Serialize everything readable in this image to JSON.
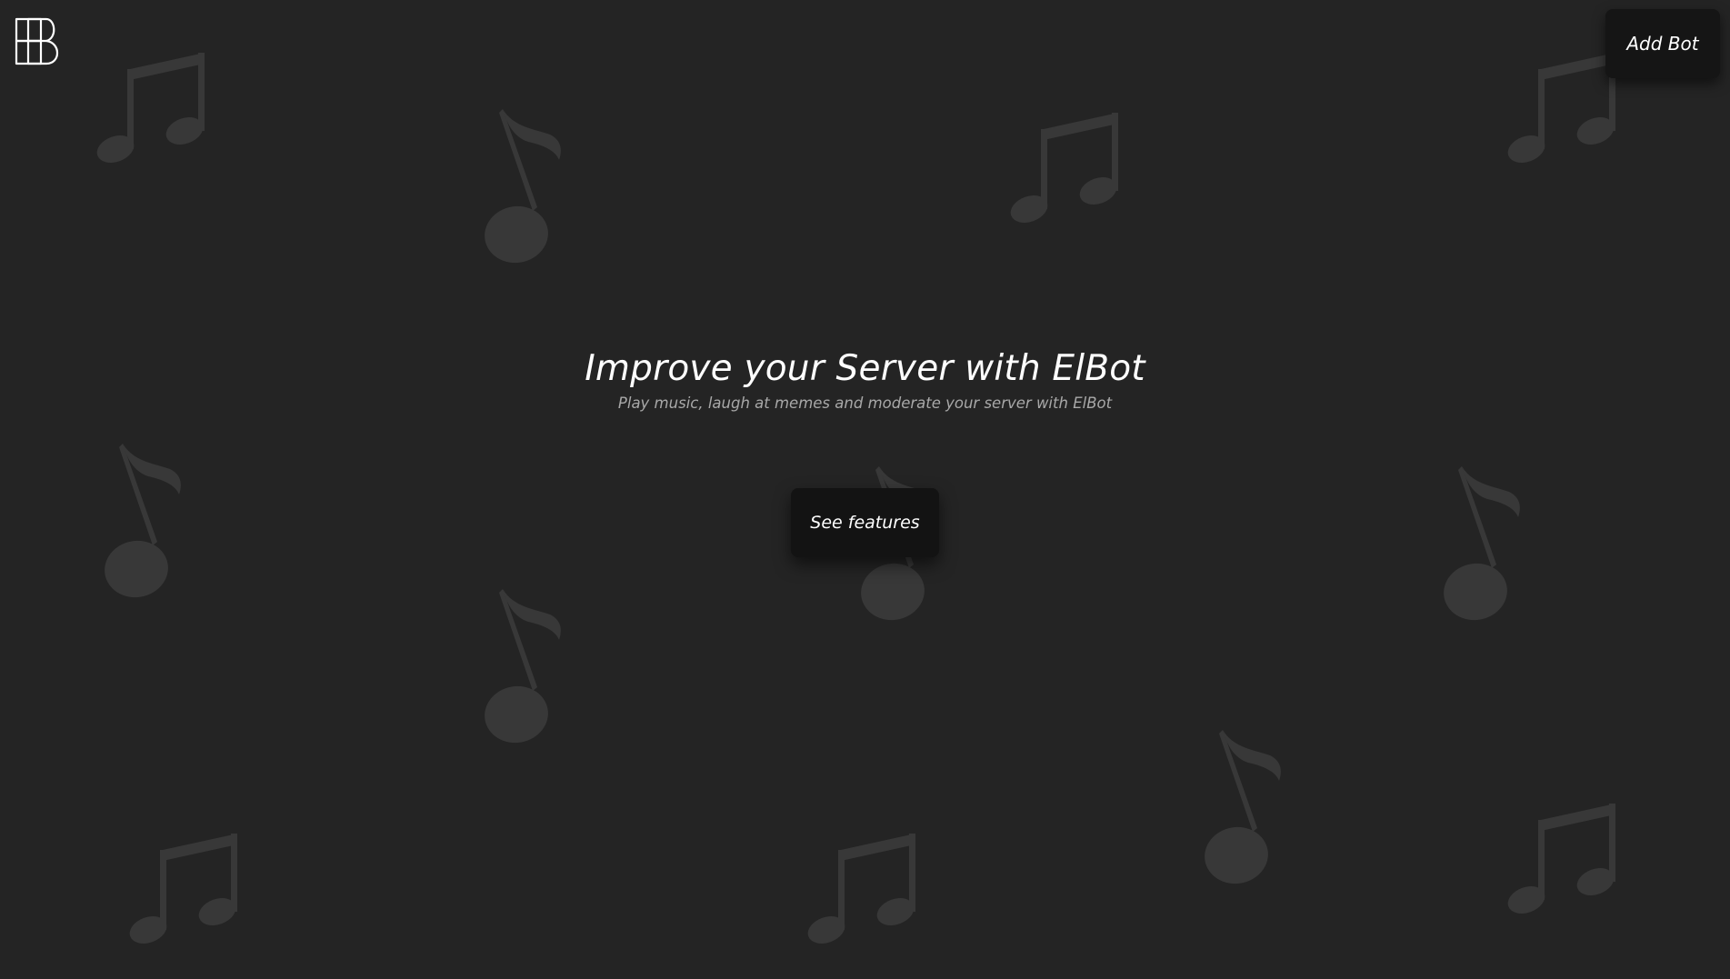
{
  "brand": {
    "logo_alt": "EB"
  },
  "header": {
    "add_bot_label": "Add Bot"
  },
  "hero": {
    "title": "Improve your Server with ElBot",
    "subtitle": "Play music, laugh at memes and moderate your server with ElBot",
    "cta_label": "See features"
  },
  "theme": {
    "background": "#242424",
    "note_color": "#383838",
    "button_bg": "#151515",
    "text_primary": "#ffffff",
    "text_secondary": "#a8a8a8"
  },
  "decorations": {
    "icons": [
      "beamed-notes-icon",
      "eighth-note-icon"
    ]
  }
}
